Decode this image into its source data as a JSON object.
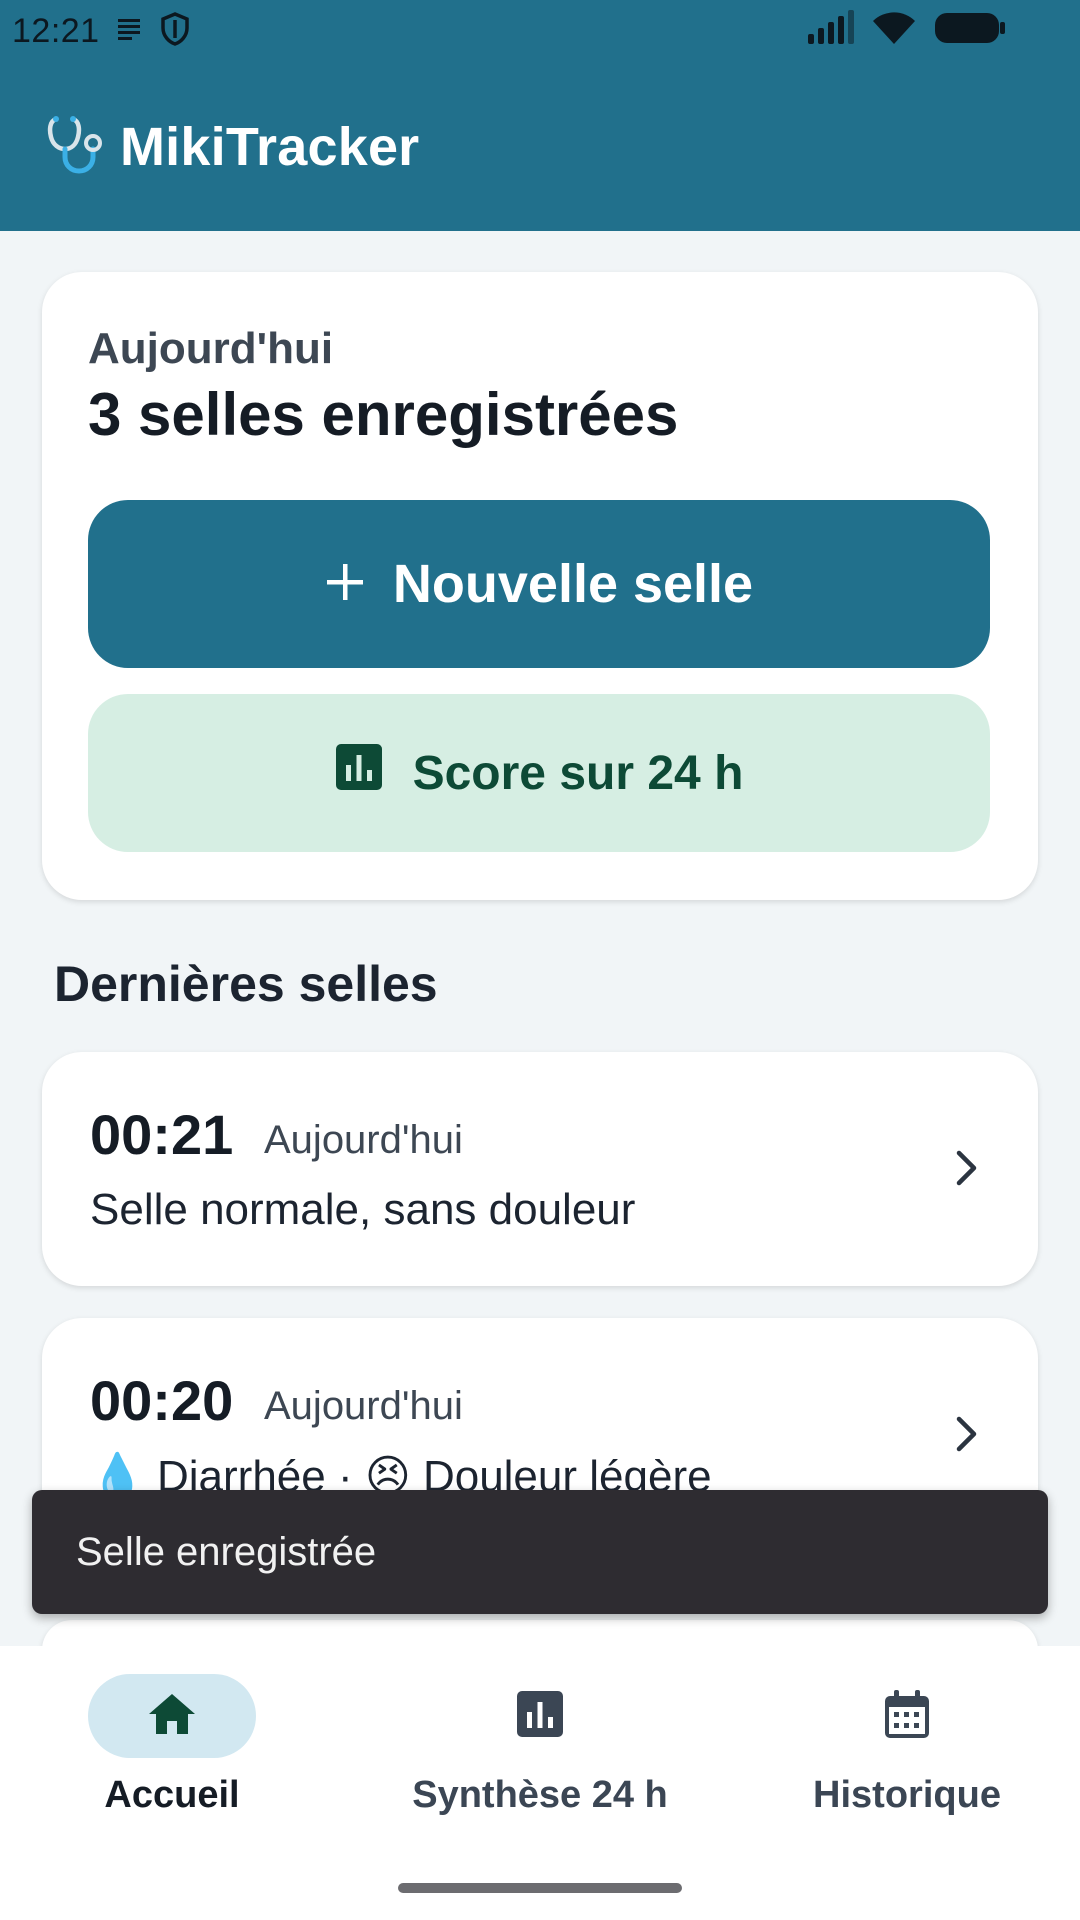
{
  "status_bar": {
    "time": "12:21",
    "icons": [
      "notification-lines-icon",
      "shield-icon",
      "cell-signal-icon",
      "wifi-icon",
      "battery-icon"
    ]
  },
  "app": {
    "title": "MikiTracker",
    "logo_icon": "stethoscope-icon"
  },
  "summary": {
    "label": "Aujourd'hui",
    "count_text": "3 selles enregistrées",
    "new_button": "Nouvelle selle",
    "score_button": "Score sur 24 h"
  },
  "recent": {
    "title": "Dernières selles",
    "entries": [
      {
        "time": "00:21",
        "day": "Aujourd'hui",
        "desc": "Selle normale, sans douleur"
      },
      {
        "time": "00:20",
        "day": "Aujourd'hui",
        "desc": "💧 Diarrhée  ·  😣 Douleur légère"
      }
    ]
  },
  "snackbar": {
    "message": "Selle enregistrée"
  },
  "nav": {
    "items": [
      {
        "label": "Accueil",
        "icon": "home-icon",
        "active": true
      },
      {
        "label": "Synthèse 24 h",
        "icon": "bar-chart-icon",
        "active": false
      },
      {
        "label": "Historique",
        "icon": "calendar-icon",
        "active": false
      }
    ]
  },
  "colors": {
    "primary": "#21708c",
    "secondary_bg": "#d6eee3",
    "secondary_text": "#0d4a36",
    "snackbar": "#2e2c31",
    "nav_active_pill": "#d2e8f1"
  }
}
